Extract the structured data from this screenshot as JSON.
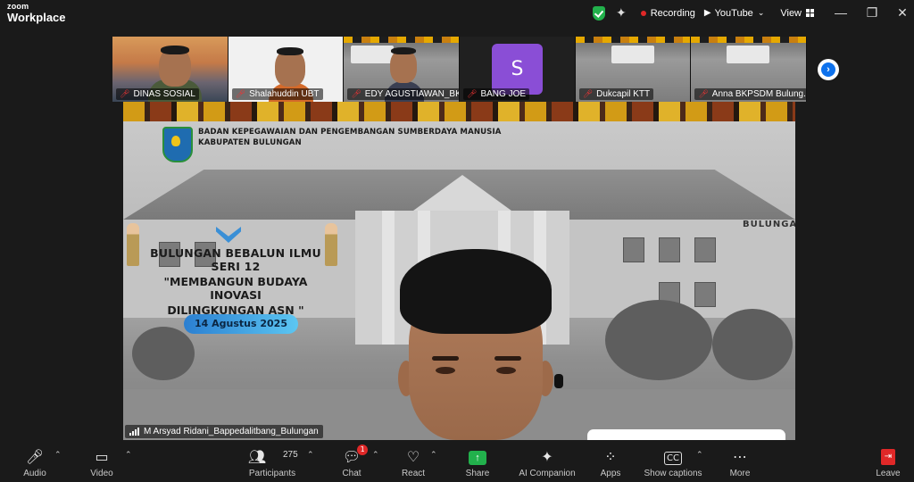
{
  "app": {
    "brand_top": "zoom",
    "brand_bottom": "Workplace"
  },
  "topbar": {
    "recording_label": "Recording",
    "youtube_label": "YouTube",
    "view_label": "View",
    "window_controls": [
      "minimize",
      "restore",
      "close"
    ]
  },
  "participants_strip": [
    {
      "name": "DINAS SOSIAL",
      "muted": true
    },
    {
      "name": "Shalahuddin UBT",
      "muted": true
    },
    {
      "name": "EDY AGUSTIAWAN_BK...",
      "muted": true
    },
    {
      "name": "BANG JOE",
      "muted": true,
      "avatar_letter": "S",
      "avatar_color": "#8a4ed6"
    },
    {
      "name": "Dukcapil KTT",
      "muted": true
    },
    {
      "name": "Anna BKPSDM Bulung...",
      "muted": true
    }
  ],
  "main_video": {
    "org_line1": "BADAN KEPEGAWAIAN DAN PENGEMBANGAN SUMBERDAYA MANUSIA",
    "org_line2": "KABUPATEN BULUNGAN",
    "event_title": "BULUNGAN BEBALUN ILMU SERI 12",
    "event_subtitle_1": "\"MEMBANGUN BUDAYA INOVASI",
    "event_subtitle_2": "DILINGKUNGAN ASN \"",
    "event_date": "14 Agustus 2025",
    "building_sign": "BULUNGA",
    "speaker_name": "M Arsyad Ridani_Bappedalitbang_Bulungan"
  },
  "toolbar": {
    "audio": "Audio",
    "video": "Video",
    "participants": "Participants",
    "participants_count": "275",
    "chat": "Chat",
    "chat_badge": "1",
    "react": "React",
    "share": "Share",
    "ai_companion": "AI Companion",
    "apps": "Apps",
    "show_captions": "Show captions",
    "more": "More",
    "leave": "Leave"
  },
  "colors": {
    "accent_blue": "#0e72ed",
    "share_green": "#22b14c",
    "record_red": "#e02828"
  }
}
